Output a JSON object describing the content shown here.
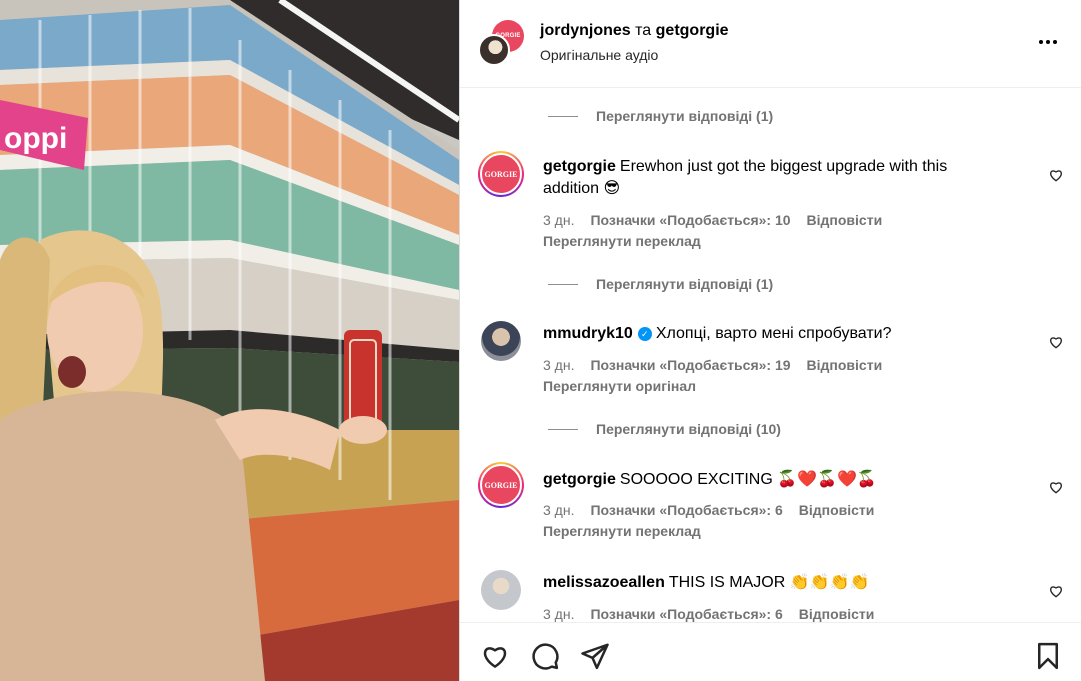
{
  "header": {
    "user_primary": "jordynjones",
    "conjunction": "та",
    "user_secondary": "getgorgie",
    "audio": "Оригінальне аудіо",
    "gorgie_avatar_text": "GORGIE"
  },
  "comments": [
    {
      "replies_label": "Переглянути відповіді (1)"
    },
    {
      "username": "getgorgie",
      "text": "Erewhon just got the biggest upgrade with this addition 😎",
      "avatar_text": "GORGIE",
      "time": "3 дн.",
      "likes": "Позначки «Подобається»: 10",
      "reply": "Відповісти",
      "translate": "Переглянути переклад",
      "replies_label": "Переглянути відповіді (1)"
    },
    {
      "username": "mmudryk10",
      "verified": true,
      "text": "Хлопці, варто мені спробувати?",
      "time": "3 дн.",
      "likes": "Позначки «Подобається»: 19",
      "reply": "Відповісти",
      "translate": "Переглянути оригінал",
      "replies_label": "Переглянути відповіді (10)"
    },
    {
      "username": "getgorgie",
      "text": "SOOOOO EXCITING 🍒❤️🍒❤️🍒",
      "avatar_text": "GORGIE",
      "time": "3 дн.",
      "likes": "Позначки «Подобається»: 6",
      "reply": "Відповісти",
      "translate": "Переглянути переклад"
    },
    {
      "username": "melissazoeallen",
      "text": "THIS IS MAJOR 👏👏👏👏",
      "time": "3 дн.",
      "likes": "Позначки «Подобається»: 6",
      "reply": "Відповісти"
    }
  ],
  "media": {
    "sign_text": "oppi"
  },
  "icons": {
    "more": "more-horizontal-icon",
    "like": "heart-icon",
    "comment": "comment-icon",
    "share": "paper-plane-icon",
    "save": "bookmark-icon"
  }
}
